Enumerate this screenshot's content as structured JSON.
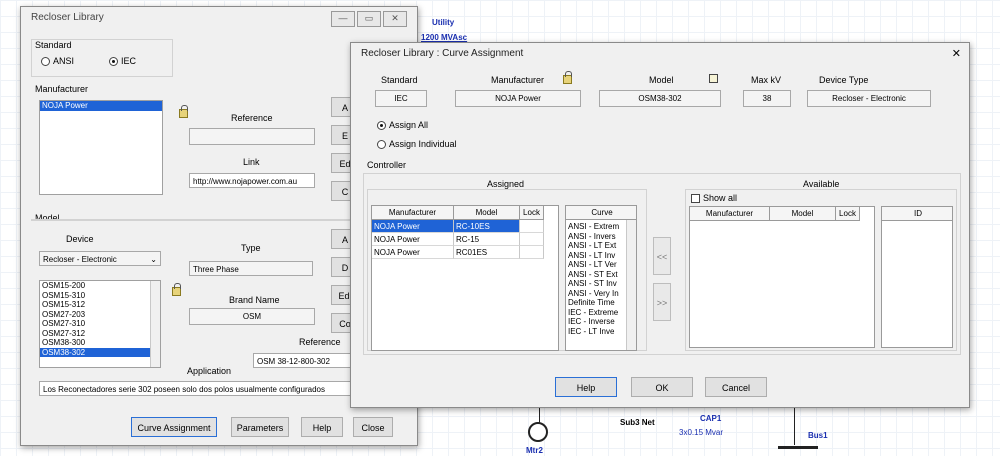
{
  "background": {
    "utility_label": "Utility",
    "utility_value": "1200 MVAsc",
    "sub_net_label": "Sub3 Net",
    "cap_label": "CAP1",
    "cap_value": "3x0.15 Mvar",
    "bus_label": "Bus1",
    "mtr_label": "Mtr2"
  },
  "library": {
    "title": "Recloser Library",
    "title_buttons": [
      "—",
      "▭",
      "✕"
    ],
    "standard_label": "Standard",
    "standard_options": [
      "ANSI",
      "IEC"
    ],
    "standard_selected": "IEC",
    "manufacturer_label": "Manufacturer",
    "manufacturers": [
      "NOJA Power"
    ],
    "manufacturer_selected": "NOJA Power",
    "reference_label": "Reference",
    "reference_value": "",
    "link_label": "Link",
    "link_value": "http://www.nojapower.com.au",
    "side_buttons_top": [
      "A",
      "E",
      "Ed",
      "C"
    ],
    "model_label": "Model",
    "device_label": "Device",
    "device_value": "Recloser - Electronic",
    "type_label": "Type",
    "type_value": "Three Phase",
    "models": [
      "OSM15-200",
      "OSM15-310",
      "OSM15-312",
      "OSM27-203",
      "OSM27-310",
      "OSM27-312",
      "OSM38-300",
      "OSM38-302"
    ],
    "model_selected": "OSM38-302",
    "brand_name_label": "Brand Name",
    "brand_name_value": "OSM",
    "side_buttons_bottom": [
      "A",
      "D",
      "Edi",
      "Co"
    ],
    "model_reference_label": "Reference",
    "model_reference_value": "OSM 38-12-800-302",
    "application_label": "Application",
    "application_value": "Los Reconectadores serie 302 poseen solo dos polos usualmente configurados",
    "buttons": {
      "curve_assignment": "Curve Assignment",
      "parameters": "Parameters",
      "help": "Help",
      "close": "Close"
    }
  },
  "curve_dialog": {
    "title": "Recloser Library : Curve Assignment",
    "close_glyph": "✕",
    "headers": {
      "standard": "Standard",
      "manufacturer": "Manufacturer",
      "model": "Model",
      "max_kv": "Max kV",
      "device_type": "Device Type"
    },
    "values": {
      "standard": "IEC",
      "manufacturer": "NOJA Power",
      "model": "OSM38-302",
      "max_kv": "38",
      "device_type": "Recloser - Electronic"
    },
    "assign_all": "Assign All",
    "assign_individual": "Assign Individual",
    "controller_label": "Controller",
    "assigned_label": "Assigned",
    "available_label": "Available",
    "show_all": "Show all",
    "assigned_columns": [
      "Manufacturer",
      "Model",
      "Lock"
    ],
    "assigned_rows": [
      {
        "manufacturer": "NOJA Power",
        "model": "RC-10ES",
        "lock": ""
      },
      {
        "manufacturer": "NOJA Power",
        "model": "RC-15",
        "lock": ""
      },
      {
        "manufacturer": "NOJA Power",
        "model": "RC01ES",
        "lock": ""
      }
    ],
    "curve_label": "Curve",
    "curves": [
      "ANSI - Extrem",
      "ANSI - Invers",
      "ANSI - LT Ext",
      "ANSI - LT Inv",
      "ANSI - LT Ver",
      "ANSI - ST Ext",
      "ANSI - ST Inv",
      "ANSI - Very In",
      "Definite Time",
      "IEC - Extreme",
      "IEC - Inverse",
      "IEC - LT Inve"
    ],
    "move_left": "<<",
    "move_right": ">>",
    "available_columns": [
      "Manufacturer",
      "Model",
      "Lock"
    ],
    "id_label": "ID",
    "buttons": {
      "help": "Help",
      "ok": "OK",
      "cancel": "Cancel"
    }
  }
}
